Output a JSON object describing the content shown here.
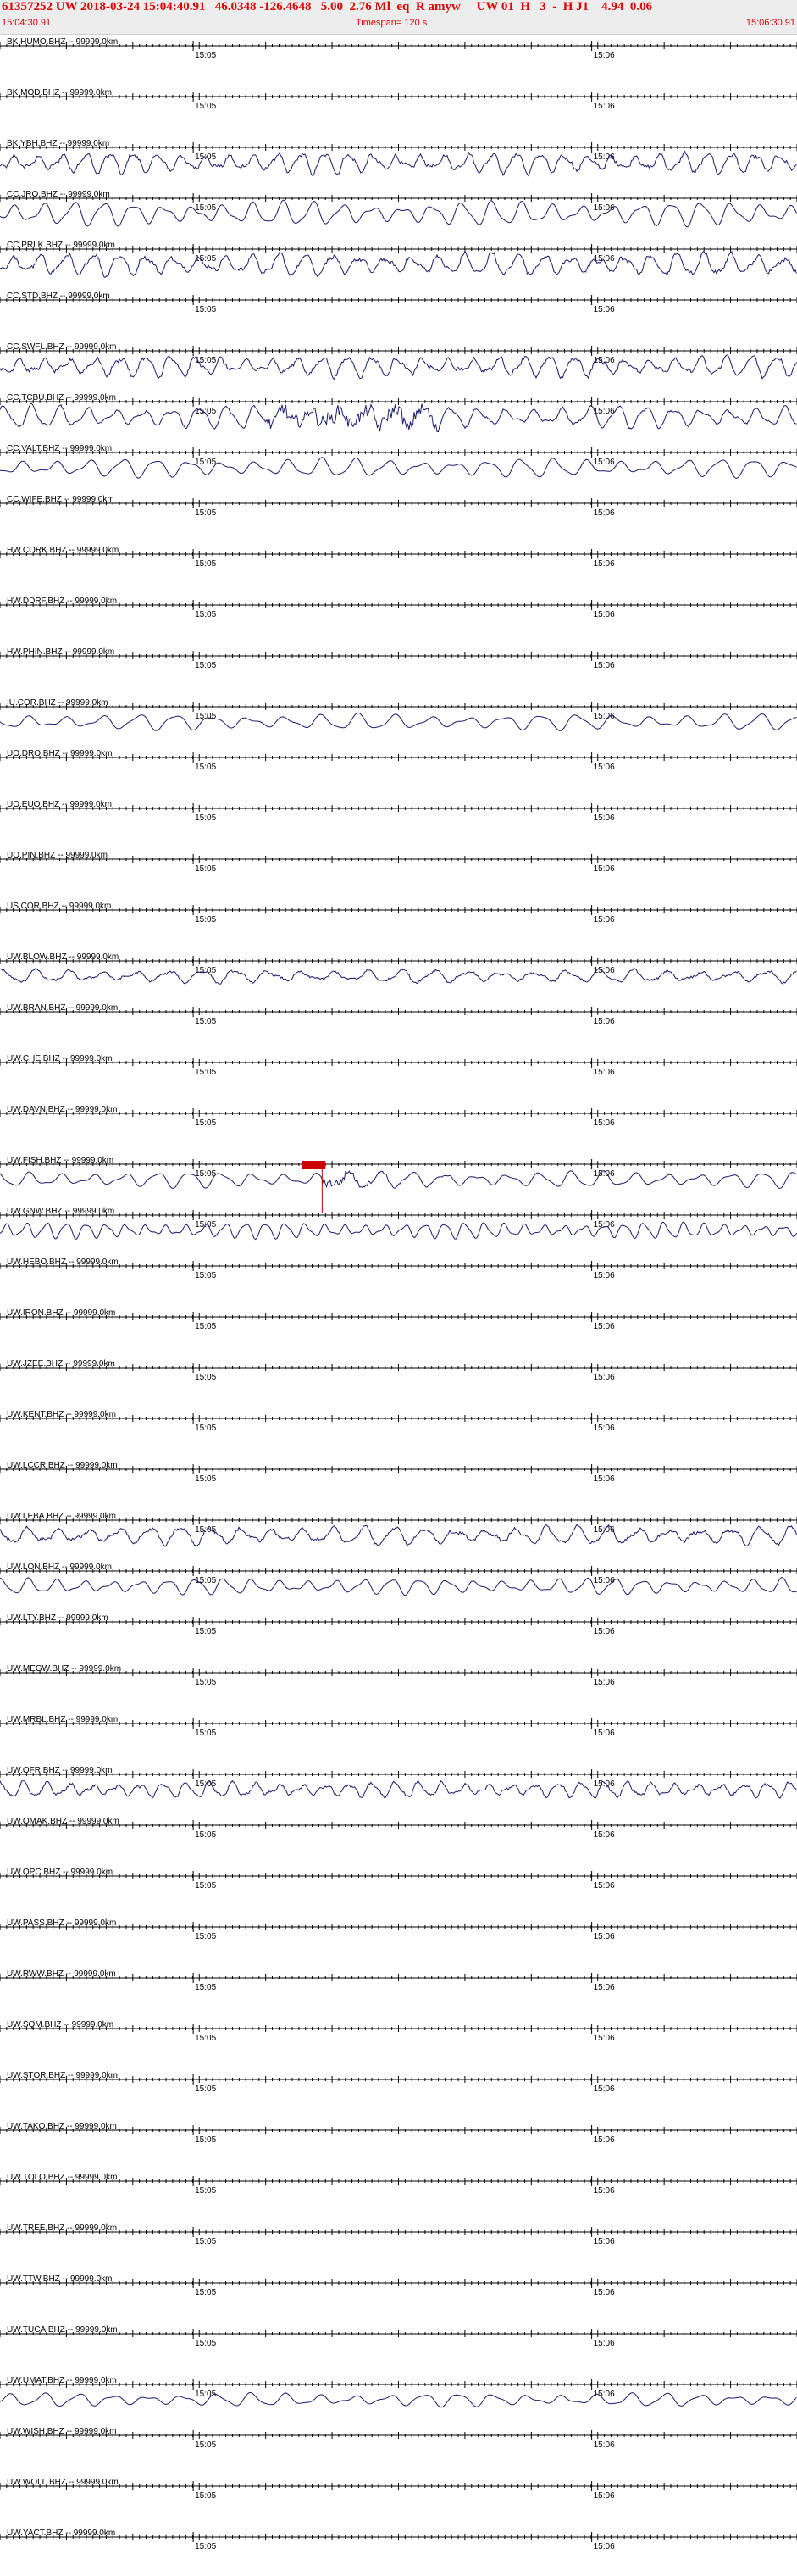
{
  "header": {
    "title": "61357252 UW 2018-03-24 15:04:40.91   46.0348 -126.4648   5.00  2.76 Ml  eq  R amyw     UW 01  H   3  -  H J1    4.94  0.06",
    "start_time": "15:04:30.91",
    "timespan": "Timespan= 120 s",
    "end_time": "15:06:30.91"
  },
  "colors": {
    "header_text": "#e00000",
    "trace": "#1a1a6e",
    "pick": "#cc0000",
    "axis": "#000000"
  },
  "chart_data": {
    "type": "line",
    "title": "61357252 UW 2018-03-24 15:04:40.91   46.0348 -126.4648   5.00  2.76 Ml  eq  R amyw     UW 01  H   3  -  H J1    4.94  0.06",
    "x_range_seconds": [
      0,
      120
    ],
    "x_start": "15:04:30.91",
    "x_end": "15:06:30.91",
    "minute_ticks": [
      {
        "label": "15:05",
        "t": 29.09
      },
      {
        "label": "15:06",
        "t": 89.09
      }
    ],
    "pick": {
      "station": "UW.FISH BHZ",
      "t": 48.5
    },
    "stations": [
      {
        "label": "BK.HUMO.BHZ -- 99999.0km",
        "signal": "none"
      },
      {
        "label": "BK.MOD.BHZ -- 99999.0km",
        "signal": "none"
      },
      {
        "label": "BK.YBH.BHZ -- 99999.0km",
        "signal": "noisy",
        "period_s": 3.6,
        "amplitude": 0.8
      },
      {
        "label": "CC.JRO.BHZ -- 99999.0km",
        "signal": "smooth",
        "period_s": 4.5,
        "amplitude": 0.9
      },
      {
        "label": "CC.PRLK.BHZ -- 99999.0km",
        "signal": "noisy",
        "period_s": 4.0,
        "amplitude": 0.85
      },
      {
        "label": "CC.STD.BHZ -- 99999.0km",
        "signal": "none"
      },
      {
        "label": "CC.SWFL.BHZ -- 99999.0km",
        "signal": "noisy",
        "period_s": 3.8,
        "amplitude": 0.8
      },
      {
        "label": "CC.TCBU.BHZ -- 99999.0km",
        "signal": "burst",
        "period_s": 4.2,
        "amplitude": 0.85
      },
      {
        "label": "CC.VALT.BHZ -- 99999.0km",
        "signal": "smooth",
        "period_s": 5.0,
        "amplitude": 0.7
      },
      {
        "label": "CC.WIFE.BHZ -- 99999.0km",
        "signal": "none"
      },
      {
        "label": "HW.CORK.BHZ -- 99999.0km",
        "signal": "none"
      },
      {
        "label": "HW.DDRF.BHZ -- 99999.0km",
        "signal": "none"
      },
      {
        "label": "HW.PHIN.BHZ -- 99999.0km",
        "signal": "none"
      },
      {
        "label": "IU.COR.BHZ -- 99999.0km",
        "signal": "smooth",
        "period_s": 5.5,
        "amplitude": 0.6
      },
      {
        "label": "UO.DRO.BHZ -- 99999.0km",
        "signal": "none"
      },
      {
        "label": "UO.EUO.BHZ -- 99999.0km",
        "signal": "none"
      },
      {
        "label": "UO.PIN.BHZ -- 99999.0km",
        "signal": "none"
      },
      {
        "label": "US.COR.BHZ -- 99999.0km",
        "signal": "none"
      },
      {
        "label": "UW.BLOW.BHZ -- 99999.0km",
        "signal": "noisy",
        "period_s": 5.0,
        "amplitude": 0.5
      },
      {
        "label": "UW.BRAN.BHZ -- 99999.0km",
        "signal": "none"
      },
      {
        "label": "UW.CHE.BHZ -- 99999.0km",
        "signal": "none"
      },
      {
        "label": "UW.DAVN.BHZ -- 99999.0km",
        "signal": "none"
      },
      {
        "label": "UW.FISH.BHZ -- 99999.0km",
        "signal": "event",
        "period_s": 4.8,
        "amplitude": 0.6
      },
      {
        "label": "UW.GNW.BHZ -- 99999.0km",
        "signal": "smooth",
        "period_s": 3.0,
        "amplitude": 0.6
      },
      {
        "label": "UW.HEBO.BHZ -- 99999.0km",
        "signal": "none"
      },
      {
        "label": "UW.IRON.BHZ -- 99999.0km",
        "signal": "none"
      },
      {
        "label": "UW.JZEE.BHZ -- 99999.0km",
        "signal": "none"
      },
      {
        "label": "UW.KENT.BHZ -- 99999.0km",
        "signal": "none"
      },
      {
        "label": "UW.LCCR.BHZ -- 99999.0km",
        "signal": "none"
      },
      {
        "label": "UW.LEBA.BHZ -- 99999.0km",
        "signal": "noisy",
        "period_s": 4.6,
        "amplitude": 0.7
      },
      {
        "label": "UW.LON.BHZ -- 99999.0km",
        "signal": "smooth",
        "period_s": 4.2,
        "amplitude": 0.6
      },
      {
        "label": "UW.LTY.BHZ -- 99999.0km",
        "signal": "none"
      },
      {
        "label": "UW.MEGW.BHZ -- 99999.0km",
        "signal": "none"
      },
      {
        "label": "UW.MRBL.BHZ -- 99999.0km",
        "signal": "none"
      },
      {
        "label": "UW.OFR.BHZ -- 99999.0km",
        "signal": "noisy",
        "period_s": 3.5,
        "amplitude": 0.6
      },
      {
        "label": "UW.OMAK.BHZ -- 99999.0km",
        "signal": "none"
      },
      {
        "label": "UW.OPC.BHZ -- 99999.0km",
        "signal": "none"
      },
      {
        "label": "UW.PASS.BHZ -- 99999.0km",
        "signal": "none"
      },
      {
        "label": "UW.RWW.BHZ -- 99999.0km",
        "signal": "none"
      },
      {
        "label": "UW.SQM.BHZ -- 99999.0km",
        "signal": "none"
      },
      {
        "label": "UW.STOR.BHZ -- 99999.0km",
        "signal": "none"
      },
      {
        "label": "UW.TAKO.BHZ -- 99999.0km",
        "signal": "none"
      },
      {
        "label": "UW.TOLO.BHZ -- 99999.0km",
        "signal": "none"
      },
      {
        "label": "UW.TREE.BHZ -- 99999.0km",
        "signal": "none"
      },
      {
        "label": "UW.TTW.BHZ -- 99999.0km",
        "signal": "none"
      },
      {
        "label": "UW.TUCA.BHZ -- 99999.0km",
        "signal": "none"
      },
      {
        "label": "UW.UMAT.BHZ -- 99999.0km",
        "signal": "smooth",
        "period_s": 5.2,
        "amplitude": 0.5
      },
      {
        "label": "UW.WISH.BHZ -- 99999.0km",
        "signal": "none"
      },
      {
        "label": "UW.WOLL.BHZ -- 99999.0km",
        "signal": "none"
      },
      {
        "label": "UW.YACT.BHZ -- 99999.0km",
        "signal": "none"
      }
    ]
  }
}
